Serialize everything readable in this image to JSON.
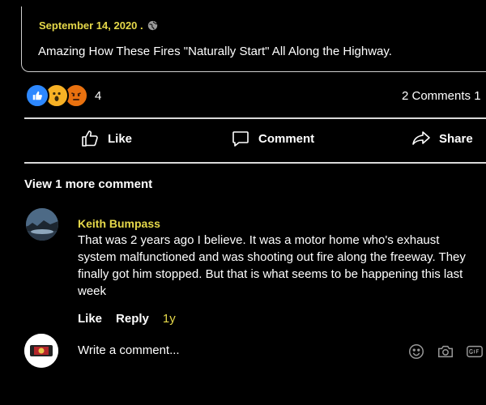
{
  "post": {
    "date": "September 14, 2020 .",
    "text": "Amazing How These Fires \"Naturally Start\" All Along the Highway."
  },
  "reactions": {
    "icons": [
      "like-icon",
      "wow-icon",
      "angry-icon"
    ],
    "count": "4",
    "comments_count": "2 Comments 1"
  },
  "actions": {
    "like": "Like",
    "comment": "Comment",
    "share": "Share"
  },
  "view_more": "View 1 more comment",
  "comment": {
    "author": "Keith Bumpass",
    "body": "That was 2 years ago I believe. It was a motor home who's exhaust system malfunctioned and was shooting out fire along the freeway. They finally got him stopped. But that is what seems to be happening this last week",
    "like": "Like",
    "reply": "Reply",
    "time": "1y"
  },
  "composer": {
    "placeholder": "Write a comment..."
  },
  "colors": {
    "background": "#000000",
    "accent_yellow": "#e5d84a",
    "like_blue": "#2d88ff"
  }
}
